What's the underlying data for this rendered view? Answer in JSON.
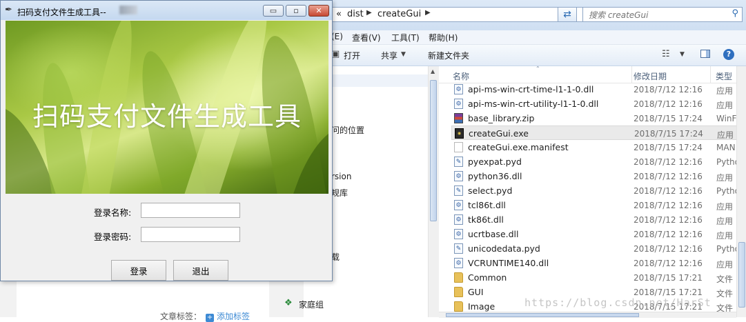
{
  "app": {
    "title": "扫码支付文件生成工具--",
    "banner_title": "扫码支付文件生成工具",
    "username_label": "登录名称:",
    "username_value": "",
    "password_label": "登录密码:",
    "password_value": "",
    "login_button": "登录",
    "exit_button": "退出",
    "controls": {
      "minimize": "▭",
      "maximize": "▫",
      "close": "✕"
    }
  },
  "explorer": {
    "breadcrumb": [
      "«",
      "dist",
      "createGui"
    ],
    "search_placeholder": "搜索 createGui",
    "menu": [
      "(E)",
      "查看(V)",
      "工具(T)",
      "帮助(H)"
    ],
    "toolbar": {
      "open": "打开",
      "share": "共享",
      "new_folder": "新建文件夹"
    },
    "nav_items": [
      "问的位置",
      "rsion",
      "规库",
      "载",
      "家庭组"
    ],
    "columns": {
      "name": "名称",
      "date": "修改日期",
      "type": "类型"
    },
    "files": [
      {
        "name": "api-ms-win-crt-time-l1-1-0.dll",
        "date": "2018/7/12 12:16",
        "type": "应用",
        "icon": "dll"
      },
      {
        "name": "api-ms-win-crt-utility-l1-1-0.dll",
        "date": "2018/7/12 12:16",
        "type": "应用",
        "icon": "dll"
      },
      {
        "name": "base_library.zip",
        "date": "2018/7/15 17:24",
        "type": "WinF",
        "icon": "zip"
      },
      {
        "name": "createGui.exe",
        "date": "2018/7/15 17:24",
        "type": "应用",
        "icon": "exe",
        "selected": true
      },
      {
        "name": "createGui.exe.manifest",
        "date": "2018/7/15 17:24",
        "type": "MAN",
        "icon": "manifest"
      },
      {
        "name": "pyexpat.pyd",
        "date": "2018/7/12 12:16",
        "type": "Pytho",
        "icon": "pyd"
      },
      {
        "name": "python36.dll",
        "date": "2018/7/12 12:16",
        "type": "应用",
        "icon": "dll"
      },
      {
        "name": "select.pyd",
        "date": "2018/7/12 12:16",
        "type": "Pytho",
        "icon": "pyd"
      },
      {
        "name": "tcl86t.dll",
        "date": "2018/7/12 12:16",
        "type": "应用",
        "icon": "dll"
      },
      {
        "name": "tk86t.dll",
        "date": "2018/7/12 12:16",
        "type": "应用",
        "icon": "dll"
      },
      {
        "name": "ucrtbase.dll",
        "date": "2018/7/12 12:16",
        "type": "应用",
        "icon": "dll"
      },
      {
        "name": "unicodedata.pyd",
        "date": "2018/7/12 12:16",
        "type": "Pytho",
        "icon": "pyd"
      },
      {
        "name": "VCRUNTIME140.dll",
        "date": "2018/7/12 12:16",
        "type": "应用",
        "icon": "dll"
      },
      {
        "name": "Common",
        "date": "2018/7/15 17:21",
        "type": "文件",
        "icon": "folder"
      },
      {
        "name": "GUI",
        "date": "2018/7/15 17:21",
        "type": "文件",
        "icon": "folder"
      },
      {
        "name": "Image",
        "date": "2018/7/15 17:21",
        "type": "文件",
        "icon": "folder"
      }
    ]
  },
  "blog": {
    "tags_label": "文章标签：",
    "add_tag": "添加标签"
  },
  "watermark": "https://blog.csdn.net/HarSt"
}
